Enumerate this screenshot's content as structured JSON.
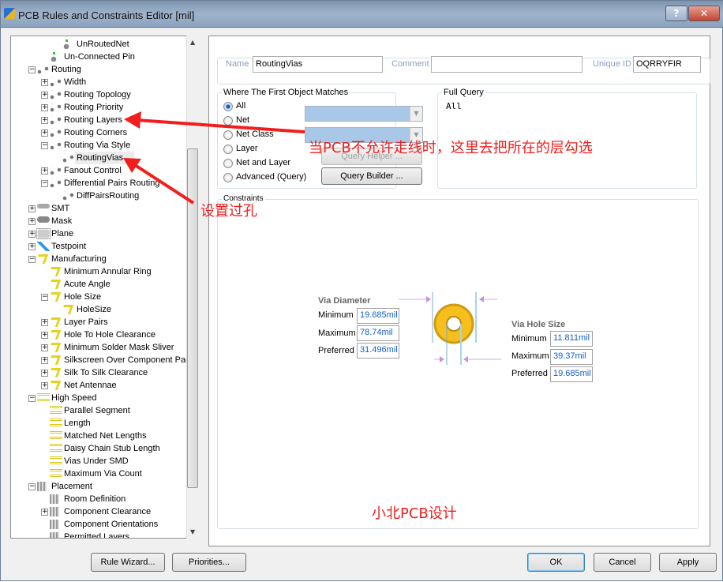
{
  "window": {
    "title": "PCB Rules and Constraints Editor [mil]",
    "help_button": "?",
    "close_button": "✕"
  },
  "tree": {
    "items": [
      {
        "label": "UnRoutedNet",
        "level": 3,
        "exp": "",
        "icon": "unrouted"
      },
      {
        "label": "Un-Connected Pin",
        "level": 2,
        "exp": "",
        "icon": "unrouted"
      },
      {
        "label": "Routing",
        "level": 1,
        "exp": "-",
        "icon": "routing"
      },
      {
        "label": "Width",
        "level": 2,
        "exp": "+",
        "icon": "routing"
      },
      {
        "label": "Routing Topology",
        "level": 2,
        "exp": "+",
        "icon": "routing"
      },
      {
        "label": "Routing Priority",
        "level": 2,
        "exp": "+",
        "icon": "routing"
      },
      {
        "label": "Routing Layers",
        "level": 2,
        "exp": "+",
        "icon": "routing"
      },
      {
        "label": "Routing Corners",
        "level": 2,
        "exp": "+",
        "icon": "routing"
      },
      {
        "label": "Routing Via Style",
        "level": 2,
        "exp": "-",
        "icon": "routing"
      },
      {
        "label": "RoutingVias",
        "level": 3,
        "exp": "",
        "icon": "routing",
        "selected": true
      },
      {
        "label": "Fanout Control",
        "level": 2,
        "exp": "+",
        "icon": "routing"
      },
      {
        "label": "Differential Pairs Routing",
        "level": 2,
        "exp": "-",
        "icon": "routing"
      },
      {
        "label": "DiffPairsRouting",
        "level": 3,
        "exp": "",
        "icon": "routing"
      },
      {
        "label": "SMT",
        "level": 1,
        "exp": "+",
        "icon": "smt"
      },
      {
        "label": "Mask",
        "level": 1,
        "exp": "+",
        "icon": "mask"
      },
      {
        "label": "Plane",
        "level": 1,
        "exp": "+",
        "icon": "plane"
      },
      {
        "label": "Testpoint",
        "level": 1,
        "exp": "+",
        "icon": "tp"
      },
      {
        "label": "Manufacturing",
        "level": 1,
        "exp": "-",
        "icon": "mfg"
      },
      {
        "label": "Minimum Annular Ring",
        "level": 2,
        "exp": "",
        "icon": "mfg"
      },
      {
        "label": "Acute Angle",
        "level": 2,
        "exp": "",
        "icon": "mfg"
      },
      {
        "label": "Hole Size",
        "level": 2,
        "exp": "-",
        "icon": "mfg"
      },
      {
        "label": "HoleSize",
        "level": 3,
        "exp": "",
        "icon": "mfg"
      },
      {
        "label": "Layer Pairs",
        "level": 2,
        "exp": "+",
        "icon": "mfg"
      },
      {
        "label": "Hole To Hole Clearance",
        "level": 2,
        "exp": "+",
        "icon": "mfg"
      },
      {
        "label": "Minimum Solder Mask Sliver",
        "level": 2,
        "exp": "+",
        "icon": "mfg"
      },
      {
        "label": "Silkscreen Over Component Pad",
        "level": 2,
        "exp": "+",
        "icon": "mfg"
      },
      {
        "label": "Silk To Silk Clearance",
        "level": 2,
        "exp": "+",
        "icon": "mfg"
      },
      {
        "label": "Net Antennae",
        "level": 2,
        "exp": "+",
        "icon": "mfg"
      },
      {
        "label": "High Speed",
        "level": 1,
        "exp": "-",
        "icon": "hs"
      },
      {
        "label": "Parallel Segment",
        "level": 2,
        "exp": "",
        "icon": "hs"
      },
      {
        "label": "Length",
        "level": 2,
        "exp": "",
        "icon": "hs"
      },
      {
        "label": "Matched Net Lengths",
        "level": 2,
        "exp": "",
        "icon": "hs"
      },
      {
        "label": "Daisy Chain Stub Length",
        "level": 2,
        "exp": "",
        "icon": "hs"
      },
      {
        "label": "Vias Under SMD",
        "level": 2,
        "exp": "",
        "icon": "hs"
      },
      {
        "label": "Maximum Via Count",
        "level": 2,
        "exp": "",
        "icon": "hs"
      },
      {
        "label": "Placement",
        "level": 1,
        "exp": "-",
        "icon": "place"
      },
      {
        "label": "Room Definition",
        "level": 2,
        "exp": "",
        "icon": "place"
      },
      {
        "label": "Component Clearance",
        "level": 2,
        "exp": "+",
        "icon": "place"
      },
      {
        "label": "Component Orientations",
        "level": 2,
        "exp": "",
        "icon": "place"
      },
      {
        "label": "Permitted Layers",
        "level": 2,
        "exp": "",
        "icon": "place"
      }
    ]
  },
  "rule": {
    "name_label": "Name",
    "name": "RoutingVias",
    "comment_label": "Comment",
    "comment": "",
    "uid_label": "Unique ID",
    "uid": "OQRRYFIR"
  },
  "match": {
    "title": "Where The First Object Matches",
    "options": [
      "All",
      "Net",
      "Net Class",
      "Layer",
      "Net and Layer",
      "Advanced (Query)"
    ],
    "selected": "All",
    "query_helper": "Query Helper ...",
    "query_builder": "Query Builder ..."
  },
  "full_query": {
    "title": "Full Query",
    "text": "All"
  },
  "constraints": {
    "title": "Constraints",
    "via_diameter": {
      "title": "Via Diameter",
      "minimum_label": "Minimum",
      "minimum": "19.685mil",
      "maximum_label": "Maximum",
      "maximum": "78.74mil",
      "preferred_label": "Preferred",
      "preferred": "31.496mil"
    },
    "via_hole": {
      "title": "Via Hole Size",
      "minimum_label": "Minimum",
      "minimum": "11.811mil",
      "maximum_label": "Maximum",
      "maximum": "39.37mil",
      "preferred_label": "Preferred",
      "preferred": "19.685mil"
    }
  },
  "annotations": {
    "layers_note": "当PCB不允许走线时，这里去把所在的层勾选",
    "via_note": "设置过孔",
    "watermark": "小北PCB设计",
    "color": "#f21e1e"
  },
  "buttons": {
    "rule_wizard": "Rule Wizard...",
    "priorities": "Priorities...",
    "ok": "OK",
    "cancel": "Cancel",
    "apply": "Apply"
  }
}
